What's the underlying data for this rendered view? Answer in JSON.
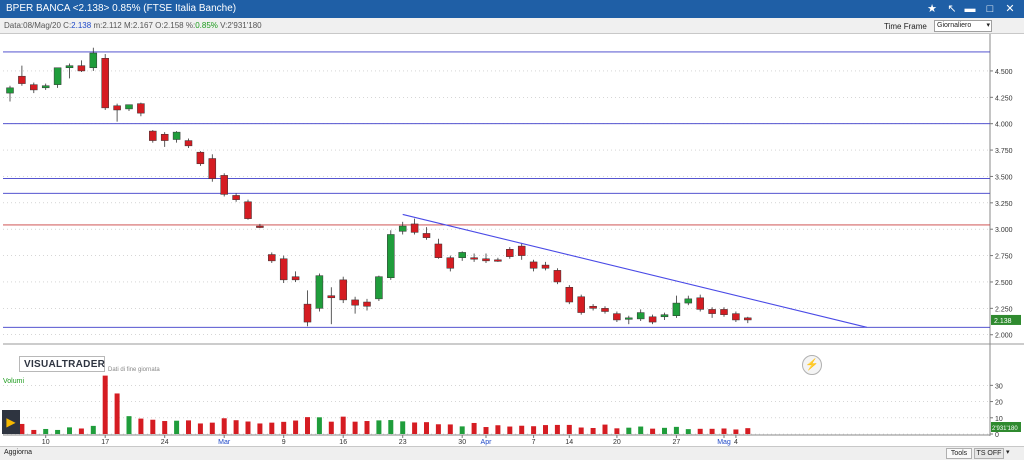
{
  "window": {
    "title": "BPER BANCA <2.138> 0.85%  (FTSE Italia Banche)",
    "btn_star": "★",
    "btn_pin": "↖",
    "btn_minimize": "▬",
    "btn_maximize": "□",
    "btn_close": "✕"
  },
  "info": {
    "date_label": "Data:",
    "date": "08/Mag/20",
    "close_label": "C:",
    "close": "2.138",
    "min_label": "m:",
    "min": "2.112",
    "max_label": "M:",
    "max": "2.167",
    "open_label": "O:",
    "open": "2.158",
    "change_label": "%:",
    "change": "0.85%",
    "volume_label": "V:",
    "volume": "2'931'180"
  },
  "timeframe": {
    "label": "Time Frame",
    "value": "Giornaliero",
    "arrow": "▾"
  },
  "logo": "VISUALTRADER",
  "eod_note": "Dati di fine giornata",
  "volume_title": "Volumi",
  "play_icon": "▶",
  "refresh_icon": "⚡",
  "bottom": {
    "aggiorna": "Aggiorna",
    "tools": "Tools",
    "tsoff": "TS OFF",
    "arrow": "▾"
  },
  "colors": {
    "up": "#1f9d3b",
    "down": "#d51c22",
    "h_blue": "#3b3bc8",
    "h_red": "#c83b3b",
    "trend": "#4a4ae6",
    "grid": "#bdbdbd"
  },
  "chart_data": [
    {
      "type": "candlestick",
      "ylim": [
        1.95,
        4.85
      ],
      "y_ticks": [
        2.0,
        2.25,
        2.5,
        2.75,
        3.0,
        3.25,
        3.5,
        3.75,
        4.0,
        4.25,
        4.5
      ],
      "y_tick_labels": [
        "2.000",
        "2.250",
        "2.500",
        "2.750",
        "3.000",
        "3.250",
        "3.500",
        "3.750",
        "4.000",
        "4.250",
        "4.500"
      ],
      "last_price_label": "2.138",
      "x_ticks": [
        {
          "index": 3,
          "label": "10"
        },
        {
          "index": 8,
          "label": "17"
        },
        {
          "index": 13,
          "label": "24"
        },
        {
          "index": 18,
          "label": "Mar"
        },
        {
          "index": 23,
          "label": "9"
        },
        {
          "index": 28,
          "label": "16"
        },
        {
          "index": 33,
          "label": "23"
        },
        {
          "index": 38,
          "label": "30"
        },
        {
          "index": 40,
          "label": "Apr"
        },
        {
          "index": 44,
          "label": "7"
        },
        {
          "index": 47,
          "label": "14"
        },
        {
          "index": 51,
          "label": "20"
        },
        {
          "index": 56,
          "label": "27"
        },
        {
          "index": 60,
          "label": "Mag"
        },
        {
          "index": 61,
          "label": "4"
        }
      ],
      "candles": [
        {
          "o": 4.29,
          "h": 4.36,
          "l": 4.21,
          "c": 4.34
        },
        {
          "o": 4.45,
          "h": 4.55,
          "l": 4.36,
          "c": 4.38
        },
        {
          "o": 4.37,
          "h": 4.39,
          "l": 4.29,
          "c": 4.32
        },
        {
          "o": 4.34,
          "h": 4.38,
          "l": 4.32,
          "c": 4.36
        },
        {
          "o": 4.37,
          "h": 4.42,
          "l": 4.34,
          "c": 4.53
        },
        {
          "o": 4.53,
          "h": 4.57,
          "l": 4.43,
          "c": 4.55
        },
        {
          "o": 4.55,
          "h": 4.6,
          "l": 4.49,
          "c": 4.5
        },
        {
          "o": 4.53,
          "h": 4.72,
          "l": 4.5,
          "c": 4.67
        },
        {
          "o": 4.62,
          "h": 4.66,
          "l": 4.13,
          "c": 4.15
        },
        {
          "o": 4.17,
          "h": 4.19,
          "l": 4.02,
          "c": 4.13
        },
        {
          "o": 4.14,
          "h": 4.18,
          "l": 4.12,
          "c": 4.18
        },
        {
          "o": 4.19,
          "h": 4.2,
          "l": 4.07,
          "c": 4.1
        },
        {
          "o": 3.93,
          "h": 3.94,
          "l": 3.82,
          "c": 3.84
        },
        {
          "o": 3.9,
          "h": 3.92,
          "l": 3.78,
          "c": 3.84
        },
        {
          "o": 3.85,
          "h": 3.93,
          "l": 3.82,
          "c": 3.92
        },
        {
          "o": 3.84,
          "h": 3.86,
          "l": 3.77,
          "c": 3.79
        },
        {
          "o": 3.73,
          "h": 3.74,
          "l": 3.6,
          "c": 3.62
        },
        {
          "o": 3.67,
          "h": 3.71,
          "l": 3.45,
          "c": 3.48
        },
        {
          "o": 3.51,
          "h": 3.53,
          "l": 3.31,
          "c": 3.33
        },
        {
          "o": 3.32,
          "h": 3.34,
          "l": 3.26,
          "c": 3.28
        },
        {
          "o": 3.26,
          "h": 3.28,
          "l": 3.09,
          "c": 3.1
        },
        {
          "o": 3.03,
          "h": 3.05,
          "l": 3.01,
          "c": 3.02
        },
        {
          "o": 2.76,
          "h": 2.78,
          "l": 2.68,
          "c": 2.7
        },
        {
          "o": 2.72,
          "h": 2.75,
          "l": 2.49,
          "c": 2.52
        },
        {
          "o": 2.55,
          "h": 2.6,
          "l": 2.5,
          "c": 2.52
        },
        {
          "o": 2.29,
          "h": 2.42,
          "l": 2.08,
          "c": 2.12
        },
        {
          "o": 2.25,
          "h": 2.58,
          "l": 2.22,
          "c": 2.56
        },
        {
          "o": 2.37,
          "h": 2.45,
          "l": 2.1,
          "c": 2.35
        },
        {
          "o": 2.52,
          "h": 2.55,
          "l": 2.3,
          "c": 2.33
        },
        {
          "o": 2.33,
          "h": 2.36,
          "l": 2.2,
          "c": 2.28
        },
        {
          "o": 2.31,
          "h": 2.34,
          "l": 2.23,
          "c": 2.27
        },
        {
          "o": 2.34,
          "h": 2.56,
          "l": 2.32,
          "c": 2.55
        },
        {
          "o": 2.54,
          "h": 2.99,
          "l": 2.52,
          "c": 2.95
        },
        {
          "o": 2.98,
          "h": 3.07,
          "l": 2.95,
          "c": 3.03
        },
        {
          "o": 3.05,
          "h": 3.1,
          "l": 2.95,
          "c": 2.97
        },
        {
          "o": 2.96,
          "h": 3.02,
          "l": 2.9,
          "c": 2.92
        },
        {
          "o": 2.86,
          "h": 2.91,
          "l": 2.72,
          "c": 2.73
        },
        {
          "o": 2.73,
          "h": 2.75,
          "l": 2.6,
          "c": 2.63
        },
        {
          "o": 2.73,
          "h": 2.79,
          "l": 2.7,
          "c": 2.78
        },
        {
          "o": 2.73,
          "h": 2.77,
          "l": 2.69,
          "c": 2.72
        },
        {
          "o": 2.72,
          "h": 2.77,
          "l": 2.68,
          "c": 2.7
        },
        {
          "o": 2.71,
          "h": 2.73,
          "l": 2.69,
          "c": 2.7
        },
        {
          "o": 2.81,
          "h": 2.83,
          "l": 2.72,
          "c": 2.74
        },
        {
          "o": 2.84,
          "h": 2.87,
          "l": 2.71,
          "c": 2.75
        },
        {
          "o": 2.69,
          "h": 2.71,
          "l": 2.6,
          "c": 2.63
        },
        {
          "o": 2.66,
          "h": 2.69,
          "l": 2.61,
          "c": 2.63
        },
        {
          "o": 2.61,
          "h": 2.63,
          "l": 2.48,
          "c": 2.5
        },
        {
          "o": 2.45,
          "h": 2.47,
          "l": 2.29,
          "c": 2.31
        },
        {
          "o": 2.36,
          "h": 2.38,
          "l": 2.19,
          "c": 2.21
        },
        {
          "o": 2.27,
          "h": 2.29,
          "l": 2.23,
          "c": 2.25
        },
        {
          "o": 2.25,
          "h": 2.27,
          "l": 2.2,
          "c": 2.22
        },
        {
          "o": 2.2,
          "h": 2.22,
          "l": 2.12,
          "c": 2.14
        },
        {
          "o": 2.15,
          "h": 2.18,
          "l": 2.1,
          "c": 2.16
        },
        {
          "o": 2.15,
          "h": 2.24,
          "l": 2.13,
          "c": 2.21
        },
        {
          "o": 2.17,
          "h": 2.19,
          "l": 2.1,
          "c": 2.12
        },
        {
          "o": 2.17,
          "h": 2.21,
          "l": 2.14,
          "c": 2.19
        },
        {
          "o": 2.18,
          "h": 2.37,
          "l": 2.16,
          "c": 2.3
        },
        {
          "o": 2.3,
          "h": 2.37,
          "l": 2.28,
          "c": 2.34
        },
        {
          "o": 2.35,
          "h": 2.38,
          "l": 2.22,
          "c": 2.24
        },
        {
          "o": 2.24,
          "h": 2.26,
          "l": 2.16,
          "c": 2.2
        },
        {
          "o": 2.24,
          "h": 2.26,
          "l": 2.17,
          "c": 2.19
        },
        {
          "o": 2.2,
          "h": 2.22,
          "l": 2.12,
          "c": 2.14
        },
        {
          "o": 2.16,
          "h": 2.17,
          "l": 2.11,
          "c": 2.14
        }
      ],
      "horizontal_lines": [
        {
          "y": 4.68,
          "color": "blue"
        },
        {
          "y": 4.0,
          "color": "blue"
        },
        {
          "y": 3.48,
          "color": "blue"
        },
        {
          "y": 3.34,
          "color": "blue"
        },
        {
          "y": 3.04,
          "color": "red"
        },
        {
          "y": 2.07,
          "color": "blue"
        }
      ],
      "trend_line": {
        "from": {
          "index": 33,
          "y": 3.14
        },
        "to": {
          "index": 72,
          "y": 2.07
        }
      }
    },
    {
      "type": "bar",
      "title": "Volumi",
      "ylim": [
        0,
        37
      ],
      "y_ticks": [
        0,
        10,
        20,
        30
      ],
      "y_tick_labels": [
        "0",
        "10",
        "20",
        "30"
      ],
      "last_volume_label": "2'931'180",
      "values": [
        3.5,
        6.2,
        2.5,
        3.1,
        2.5,
        4.1,
        3.4,
        5.0,
        36.0,
        25.0,
        11.0,
        9.5,
        8.8,
        8.0,
        8.2,
        8.4,
        6.5,
        7.0,
        9.7,
        8.5,
        7.7,
        6.5,
        7.0,
        7.5,
        8.3,
        10.4,
        10.3,
        7.6,
        10.7,
        7.6,
        8.0,
        8.4,
        8.6,
        7.8,
        7.1,
        7.3,
        6.0,
        5.9,
        4.7,
        6.8,
        4.3,
        5.4,
        4.6,
        5.1,
        4.8,
        5.5,
        5.6,
        5.6,
        4.0,
        3.7,
        5.8,
        3.5,
        3.9,
        4.6,
        3.3,
        3.8,
        4.4,
        3.0,
        3.2,
        3.2,
        3.4,
        2.8,
        3.6
      ]
    }
  ]
}
